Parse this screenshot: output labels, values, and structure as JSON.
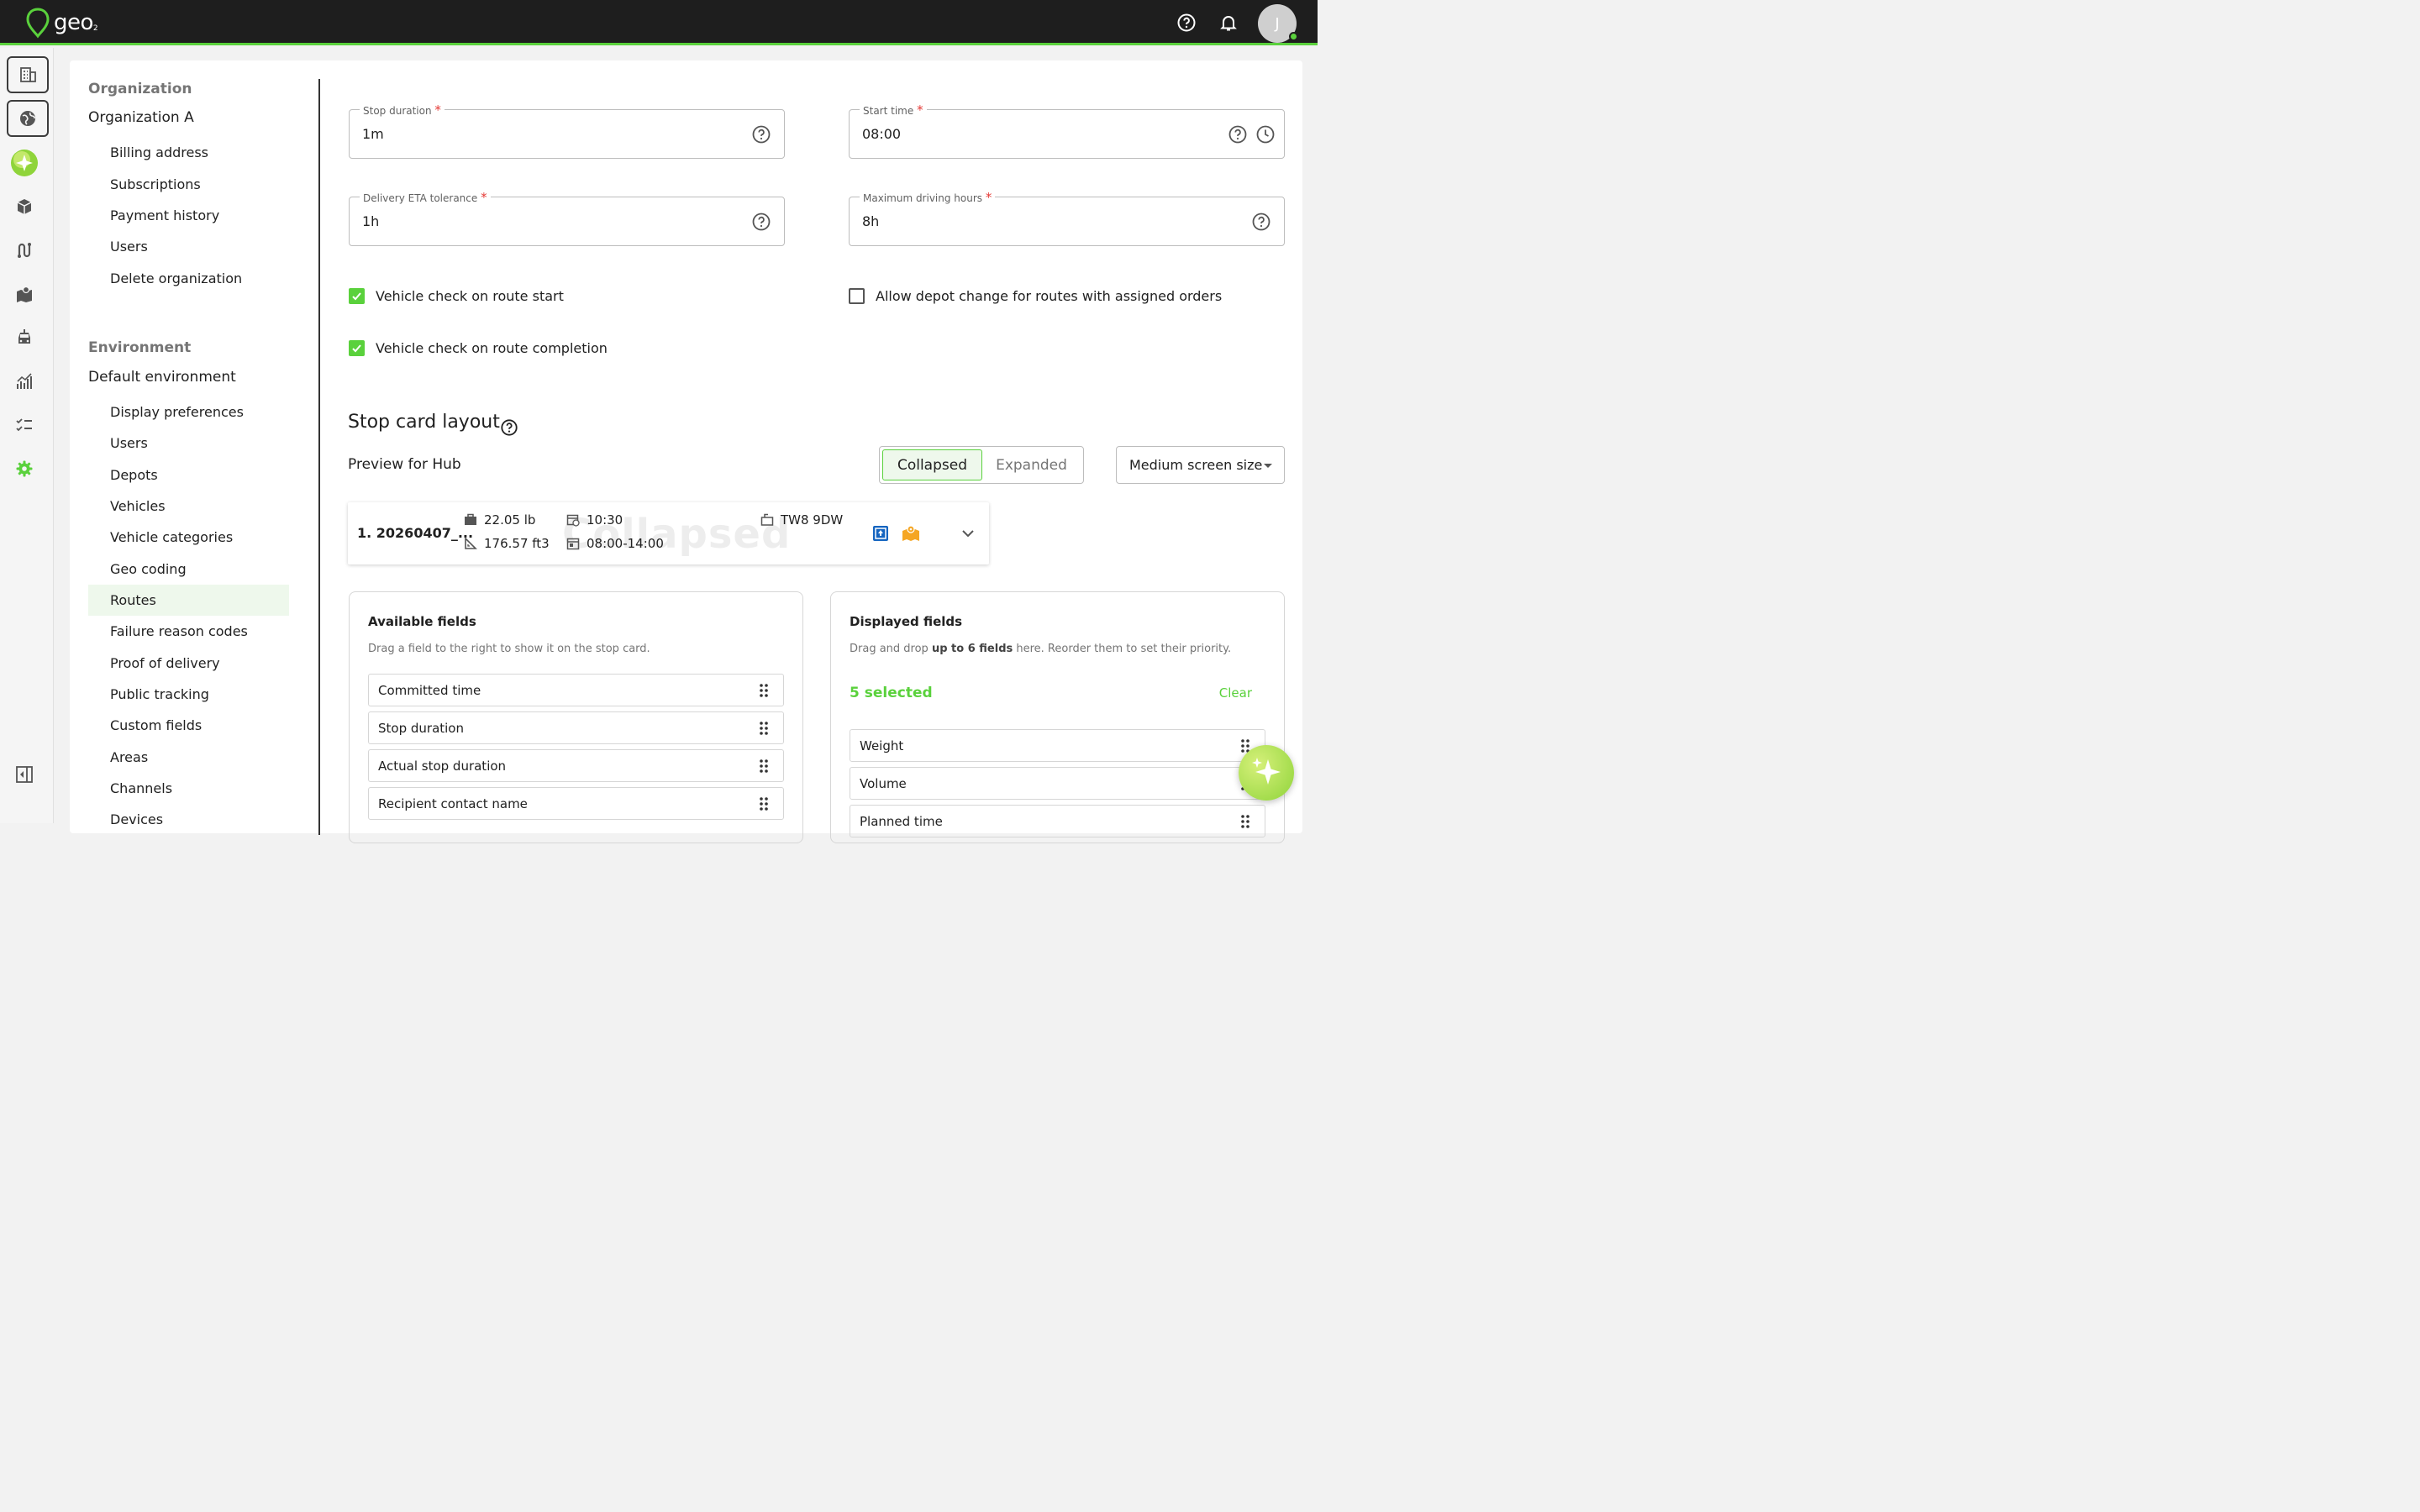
{
  "app": {
    "logo_text": "geo",
    "logo_sub": "2",
    "avatar_initial": "J"
  },
  "colors": {
    "accent": "#5ad13c",
    "topbar": "#1e1e1e",
    "required": "#e53935"
  },
  "topbar_icons": [
    "help-icon",
    "bell-icon"
  ],
  "rail_icons": [
    "building-icon",
    "globe-icon",
    "ai-sparkle-icon",
    "package-icon",
    "route-icon",
    "map-icon",
    "vehicle-icon",
    "analytics-icon",
    "checklist-icon",
    "settings-icon",
    "collapse-sidebar-icon"
  ],
  "nav": {
    "org_heading": "Organization",
    "org_name": "Organization A",
    "org_items": [
      "Billing address",
      "Subscriptions",
      "Payment history",
      "Users",
      "Delete organization"
    ],
    "env_heading": "Environment",
    "env_name": "Default environment",
    "env_items": [
      "Display preferences",
      "Users",
      "Depots",
      "Vehicles",
      "Vehicle categories",
      "Geo coding",
      "Routes",
      "Failure reason codes",
      "Proof of delivery",
      "Public tracking",
      "Custom fields",
      "Areas",
      "Channels",
      "Devices"
    ],
    "active_item": "Routes"
  },
  "fields": {
    "stop_duration": {
      "label": "Stop duration",
      "value": "1m",
      "required": "*"
    },
    "start_time": {
      "label": "Start time",
      "value": "08:00",
      "required": "*"
    },
    "eta_tolerance": {
      "label": "Delivery ETA tolerance",
      "value": "1h",
      "required": "*"
    },
    "max_driving": {
      "label": "Maximum driving hours",
      "value": "8h",
      "required": "*"
    }
  },
  "checkboxes": {
    "route_start": {
      "label": "Vehicle check on route start",
      "checked": true
    },
    "depot_change": {
      "label": "Allow depot change for routes with assigned orders",
      "checked": false
    },
    "route_completion": {
      "label": "Vehicle check on route completion",
      "checked": true
    }
  },
  "stop_card": {
    "title": "Stop card layout",
    "preview_label": "Preview for Hub",
    "toggle": {
      "collapsed": "Collapsed",
      "expanded": "Expanded",
      "selected": "Collapsed"
    },
    "screen_size": "Medium screen size",
    "card": {
      "title": "1. 20260407_...",
      "weight": "22.05 lb",
      "volume": "176.57 ft3",
      "time": "10:30",
      "window": "08:00-14:00",
      "postcode": "TW8 9DW",
      "watermark": "Collapsed"
    }
  },
  "available": {
    "title": "Available fields",
    "desc": "Drag a field to the right to show it on the stop card.",
    "items": [
      "Committed time",
      "Stop duration",
      "Actual stop duration",
      "Recipient contact name"
    ]
  },
  "displayed": {
    "title": "Displayed fields",
    "desc_pre": "Drag and drop ",
    "desc_bold": "up to 6 fields",
    "desc_post": " here. Reorder them to set their priority.",
    "selected_count": "5 selected",
    "clear": "Clear",
    "items": [
      "Weight",
      "Volume",
      "Planned time"
    ]
  }
}
